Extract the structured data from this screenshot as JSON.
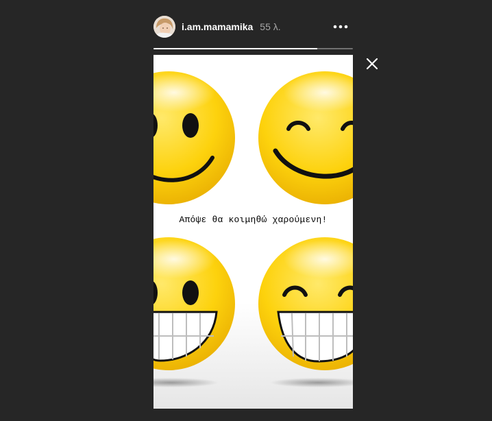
{
  "header": {
    "username": "i.am.mamamika",
    "timestamp": "55 λ."
  },
  "story": {
    "progress_fraction": 0.82,
    "caption": "Απόψε θα κοιμηθώ χαρούμενη!"
  },
  "icons": {
    "more": "more-options-icon",
    "close": "close-icon",
    "avatar": "profile-avatar"
  },
  "colors": {
    "background": "#262626",
    "smiley_yellow": "#f5c400",
    "text_secondary": "#a8a8a8"
  }
}
